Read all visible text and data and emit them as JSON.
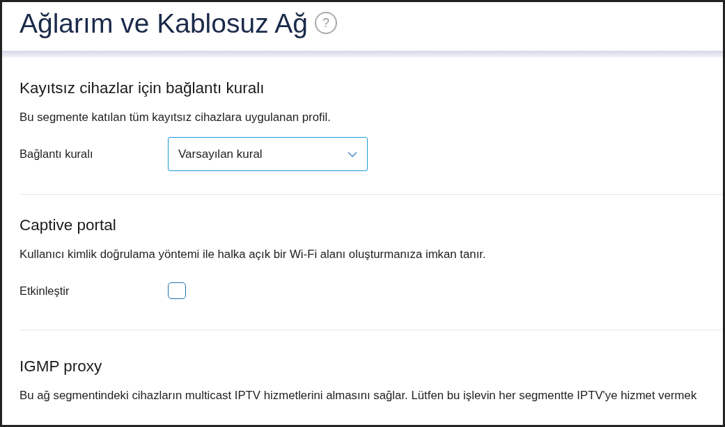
{
  "page_title": "Ağlarım ve Kablosuz Ağ",
  "help_icon": "?",
  "sections": [
    {
      "kind": "select",
      "title": "Kayıtsız cihazlar için bağlantı kuralı",
      "description": "Bu segmente katılan tüm kayıtsız cihazlara uygulanan profil.",
      "field_label": "Bağlantı kuralı",
      "value": "Varsayılan kural"
    },
    {
      "kind": "checkbox",
      "title": "Captive portal",
      "description": "Kullanıcı kimlik doğrulama yöntemi ile halka açık bir Wi-Fi alanı oluşturmanıza imkan tanır.",
      "field_label": "Etkinleştir",
      "checked": false
    },
    {
      "kind": "text",
      "title": "IGMP proxy",
      "description": "Bu ağ segmentindeki cihazların multicast IPTV hizmetlerini almasını sağlar. Lütfen bu işlevin her segmentte IPTV'ye hizmet vermek"
    }
  ]
}
